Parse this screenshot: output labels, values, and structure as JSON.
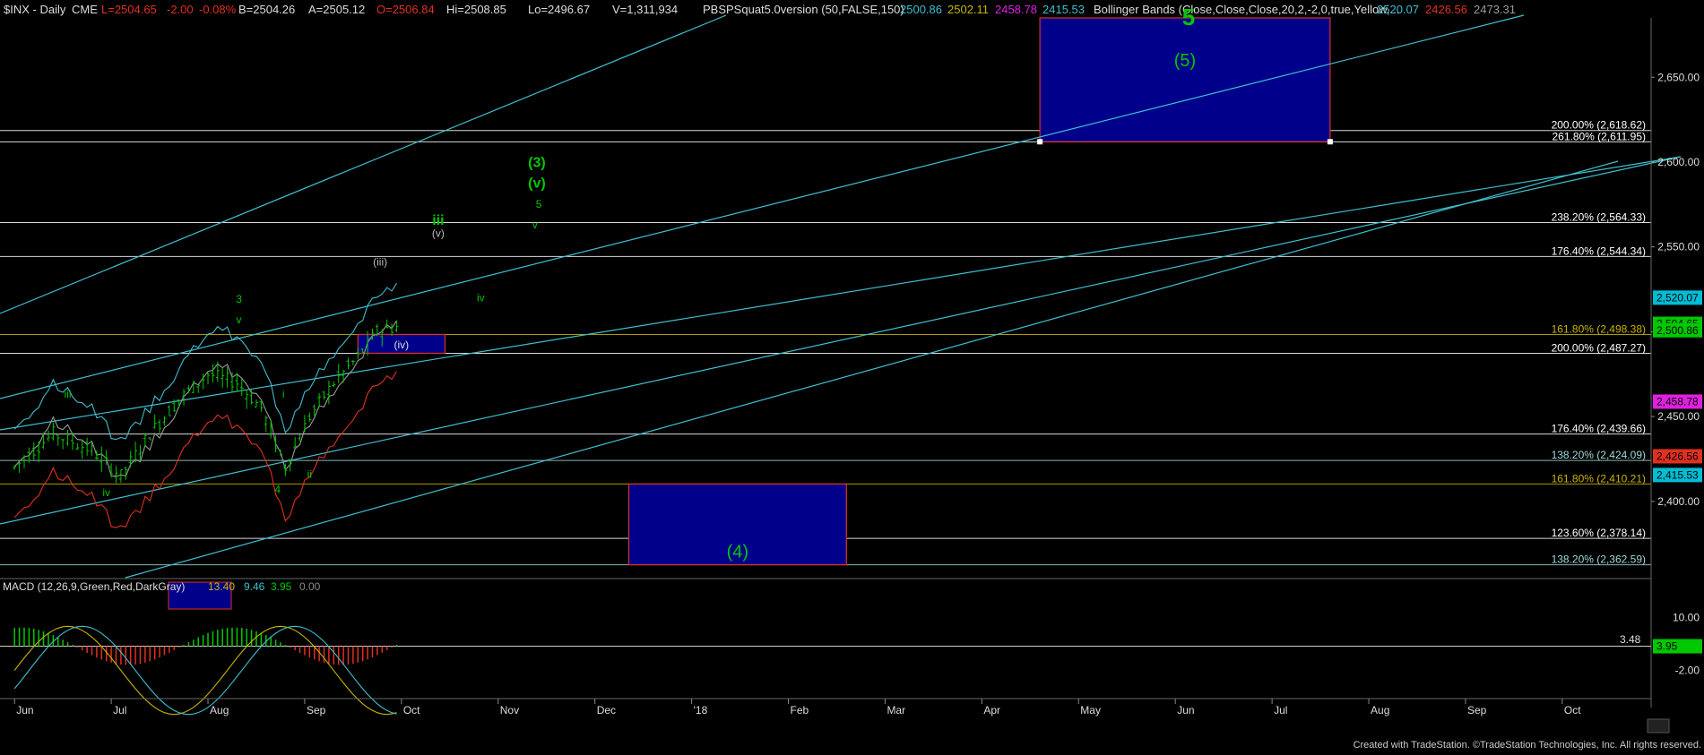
{
  "header": {
    "symbol": "$INX - Daily",
    "exchange": "CME",
    "last": "L=2504.65",
    "change": "-2.00",
    "pct_change": "-0.08%",
    "bid": "B=2504.26",
    "ask": "A=2505.12",
    "open": "O=2506.84",
    "high": "Hi=2508.85",
    "low": "Lo=2496.67",
    "volume": "V=1,311,934",
    "study1": "PBSPSquat5.0version (50,FALSE,150)",
    "study1_values": [
      "2500.86",
      "2502.11",
      "2458.78",
      "2415.53"
    ],
    "study2": "Bollinger Bands (Close,Close,Close,20,2,-2,0,true,Yellow,...",
    "study2_values": [
      "2520.07",
      "2426.56",
      "2473.31"
    ]
  },
  "macd": {
    "label": "MACD (12,26,9,Green,Red,DarkGray)",
    "values": [
      "13.40",
      "9.46",
      "3.95",
      "0.00"
    ],
    "level_label": "3.48",
    "axis_ticks": [
      "10.00",
      "-2.00"
    ],
    "axis_tick_values": [
      10,
      -2
    ],
    "axis_box": "3.95"
  },
  "chart_data": {
    "type": "candlestick",
    "title": "$INX - Daily",
    "ylim": [
      2355,
      2685
    ],
    "y_ticks": [
      2400,
      2450,
      2500,
      2550,
      2600,
      2650
    ],
    "y_tick_labels": [
      "2,400.00",
      "2,450.00",
      "2,500.00",
      "2,550.00",
      "2,600.00",
      "2,650.00"
    ],
    "x_tick_labels": [
      "Jun",
      "Jul",
      "Aug",
      "Sep",
      "Oct",
      "Nov",
      "Dec",
      "'18",
      "Feb",
      "Mar",
      "Apr",
      "May",
      "Jun",
      "Jul",
      "Aug",
      "Sep",
      "Oct"
    ],
    "fib_levels": [
      {
        "label": "200.00% (2,618.62)",
        "value": 2618.62,
        "color": "#ffffff"
      },
      {
        "label": "261.80% (2,611.95)",
        "value": 2611.95,
        "color": "#ffffff"
      },
      {
        "label": "238.20% (2,564.33)",
        "value": 2564.33,
        "color": "#ffffff"
      },
      {
        "label": "176.40% (2,544.34)",
        "value": 2544.34,
        "color": "#ffffff"
      },
      {
        "label": "161.80% (2,498.38)",
        "value": 2498.38,
        "color": "#c8b400"
      },
      {
        "label": "200.00% (2,487.27)",
        "value": 2487.27,
        "color": "#ffffff"
      },
      {
        "label": "176.40% (2,439.66)",
        "value": 2439.66,
        "color": "#ffffff"
      },
      {
        "label": "138.20% (2,424.09)",
        "value": 2424.09,
        "color": "#9fd8d8"
      },
      {
        "label": "161.80% (2,410.21)",
        "value": 2410.21,
        "color": "#c8b400"
      },
      {
        "label": "123.60% (2,378.14)",
        "value": 2378.14,
        "color": "#ffffff"
      },
      {
        "label": "138.20% (2,362.59)",
        "value": 2362.59,
        "color": "#9fd8d8"
      }
    ],
    "price_boxes": [
      {
        "label": "2,520.07",
        "value": 2520.07,
        "color": "#00bcd4"
      },
      {
        "label": "2,504.65",
        "value": 2504.65,
        "color": "#00c800"
      },
      {
        "label": "2,500.86",
        "value": 2500.86,
        "color": "#00c800"
      },
      {
        "label": "2,458.78",
        "value": 2458.78,
        "color": "#e020e0"
      },
      {
        "label": "2,426.56",
        "value": 2426.56,
        "color": "#e03020"
      },
      {
        "label": "2,415.53",
        "value": 2415.53,
        "color": "#00bcd4"
      }
    ],
    "target_boxes": [
      {
        "label": "(5)",
        "extra_label": "5",
        "from_month": 10.6,
        "to_month": 13.6,
        "low": 2612,
        "high": 2688
      },
      {
        "label": "(4)",
        "from_month": 6.35,
        "to_month": 8.6,
        "low": 2362.6,
        "high": 2410.2
      },
      {
        "label": "(iv)",
        "from_month": 3.55,
        "to_month": 4.45,
        "low": 2487.3,
        "high": 2498.4
      }
    ],
    "wave_labels": [
      {
        "text": "iii",
        "month": 0.55,
        "price": 2461,
        "color": "#00c800"
      },
      {
        "text": "iv",
        "month": 0.95,
        "price": 2403,
        "color": "#00c800"
      },
      {
        "text": "3",
        "month": 2.32,
        "price": 2517,
        "color": "#00c800"
      },
      {
        "text": "v",
        "month": 2.32,
        "price": 2505,
        "color": "#00c800"
      },
      {
        "text": "i",
        "month": 2.78,
        "price": 2461,
        "color": "#00c800"
      },
      {
        "text": "ii",
        "month": 3.05,
        "price": 2414,
        "color": "#00c800"
      },
      {
        "text": "4",
        "month": 2.72,
        "price": 2405,
        "color": "#00c800"
      },
      {
        "text": "(iii)",
        "month": 3.78,
        "price": 2539,
        "color": "#bbbbbb"
      },
      {
        "text": "iii",
        "month": 4.38,
        "price": 2563,
        "color": "#00c800"
      },
      {
        "text": "(v)",
        "month": 4.38,
        "price": 2556,
        "color": "#bbbbbb"
      },
      {
        "text": "iv",
        "month": 4.82,
        "price": 2518,
        "color": "#00c800"
      },
      {
        "text": "(3)",
        "month": 5.4,
        "price": 2597,
        "color": "#00c800"
      },
      {
        "text": "(v)",
        "month": 5.4,
        "price": 2585,
        "color": "#00c800"
      },
      {
        "text": "5",
        "month": 5.42,
        "price": 2573,
        "color": "#00c800"
      },
      {
        "text": "v",
        "month": 5.38,
        "price": 2561,
        "color": "#00c800"
      }
    ],
    "x_range_months": [
      -0.15,
      16.9
    ]
  },
  "footer": {
    "credit": "Created with TradeStation. ©TradeStation Technologies, Inc. All rights reserved."
  },
  "colors": {
    "background": "#000000",
    "candles": "#00c800",
    "channel": "#3fbfcf",
    "target_box_fill": "#00008b",
    "target_box_border": "#e03020"
  }
}
